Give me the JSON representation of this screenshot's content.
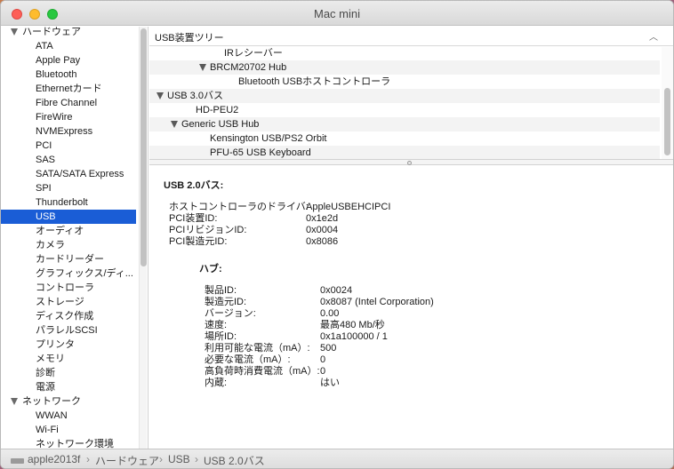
{
  "window": {
    "title": "Mac mini"
  },
  "sidebar": {
    "rows": [
      {
        "label": "ハードウェア",
        "kind": "group"
      },
      {
        "label": "ATA",
        "kind": "item"
      },
      {
        "label": "Apple Pay",
        "kind": "item"
      },
      {
        "label": "Bluetooth",
        "kind": "item"
      },
      {
        "label": "Ethernetカード",
        "kind": "item"
      },
      {
        "label": "Fibre Channel",
        "kind": "item"
      },
      {
        "label": "FireWire",
        "kind": "item"
      },
      {
        "label": "NVMExpress",
        "kind": "item"
      },
      {
        "label": "PCI",
        "kind": "item"
      },
      {
        "label": "SAS",
        "kind": "item"
      },
      {
        "label": "SATA/SATA Express",
        "kind": "item"
      },
      {
        "label": "SPI",
        "kind": "item"
      },
      {
        "label": "Thunderbolt",
        "kind": "item"
      },
      {
        "label": "USB",
        "kind": "item",
        "selected": true
      },
      {
        "label": "オーディオ",
        "kind": "item"
      },
      {
        "label": "カメラ",
        "kind": "item"
      },
      {
        "label": "カードリーダー",
        "kind": "item"
      },
      {
        "label": "グラフィックス/ディ...",
        "kind": "item"
      },
      {
        "label": "コントローラ",
        "kind": "item"
      },
      {
        "label": "ストレージ",
        "kind": "item"
      },
      {
        "label": "ディスク作成",
        "kind": "item"
      },
      {
        "label": "パラレルSCSI",
        "kind": "item"
      },
      {
        "label": "プリンタ",
        "kind": "item"
      },
      {
        "label": "メモリ",
        "kind": "item"
      },
      {
        "label": "診断",
        "kind": "item"
      },
      {
        "label": "電源",
        "kind": "item"
      },
      {
        "label": "ネットワーク",
        "kind": "group"
      },
      {
        "label": "WWAN",
        "kind": "item"
      },
      {
        "label": "Wi-Fi",
        "kind": "item"
      },
      {
        "label": "ネットワーク環境",
        "kind": "item"
      }
    ]
  },
  "tree": {
    "header": "USB装置ツリー",
    "rows": [
      {
        "label": "IRレシーバー",
        "level": 4,
        "expandable": false
      },
      {
        "label": "BRCM20702 Hub",
        "level": 3,
        "expandable": true
      },
      {
        "label": "Bluetooth USBホストコントローラ",
        "level": 5,
        "expandable": false
      },
      {
        "label": "USB 3.0バス",
        "level": 0,
        "expandable": true
      },
      {
        "label": "HD-PEU2",
        "level": 2,
        "expandable": false
      },
      {
        "label": "Generic USB Hub",
        "level": 1,
        "expandable": true
      },
      {
        "label": "Kensington USB/PS2 Orbit",
        "level": 3,
        "expandable": false
      },
      {
        "label": "PFU-65 USB Keyboard",
        "level": 3,
        "expandable": false
      }
    ]
  },
  "detail": {
    "title": "USB 2.0バス:",
    "bus_fields": [
      {
        "key": "ホストコントローラのドライバ:",
        "value": "AppleUSBEHCIPCI"
      },
      {
        "key": "PCI装置ID:",
        "value": "0x1e2d"
      },
      {
        "key": "PCIリビジョンID:",
        "value": "0x0004"
      },
      {
        "key": "PCI製造元ID:",
        "value": "0x8086"
      }
    ],
    "hub_title": "ハブ:",
    "hub_fields": [
      {
        "key": "製品ID:",
        "value": "0x0024"
      },
      {
        "key": "製造元ID:",
        "value": "0x8087  (Intel Corporation)"
      },
      {
        "key": "バージョン:",
        "value": "0.00"
      },
      {
        "key": "速度:",
        "value": "最高480 Mb/秒"
      },
      {
        "key": "場所ID:",
        "value": "0x1a100000 / 1"
      },
      {
        "key": "利用可能な電流（mA）:",
        "value": "500"
      },
      {
        "key": "必要な電流（mA）:",
        "value": "0"
      },
      {
        "key": "高負荷時消費電流（mA）:",
        "value": "0"
      },
      {
        "key": "内蔵:",
        "value": "はい"
      }
    ]
  },
  "statusbar": {
    "icon": "computer-icon",
    "crumbs": [
      "apple2013f",
      "ハードウェア",
      "USB",
      "USB 2.0バス"
    ]
  }
}
